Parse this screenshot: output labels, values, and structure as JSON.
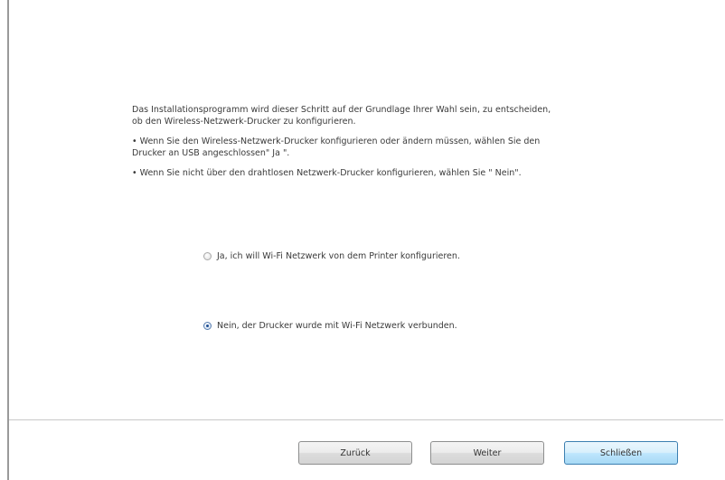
{
  "dialog": {
    "intro_text": "Das Installationsprogramm wird dieser Schritt auf der Grundlage Ihrer Wahl sein, zu entscheiden, ob den Wireless-Netzwerk-Drucker zu konfigurieren.",
    "bullets": [
      "• Wenn Sie den Wireless-Netzwerk-Drucker konfigurieren oder ändern müssen, wählen Sie den Drucker an USB angeschlossen\" Ja \".",
      "• Wenn Sie nicht über den drahtlosen Netzwerk-Drucker konfigurieren, wählen Sie \" Nein\"."
    ],
    "options": [
      {
        "label": "Ja, ich will Wi-Fi Netzwerk von dem Printer konfigurieren.",
        "selected": false
      },
      {
        "label": "Nein, der Drucker wurde mit Wi-Fi Netzwerk verbunden.",
        "selected": true
      }
    ]
  },
  "buttons": {
    "back_label": "Zurück",
    "next_label": "Weiter",
    "close_label": "Schließen"
  }
}
